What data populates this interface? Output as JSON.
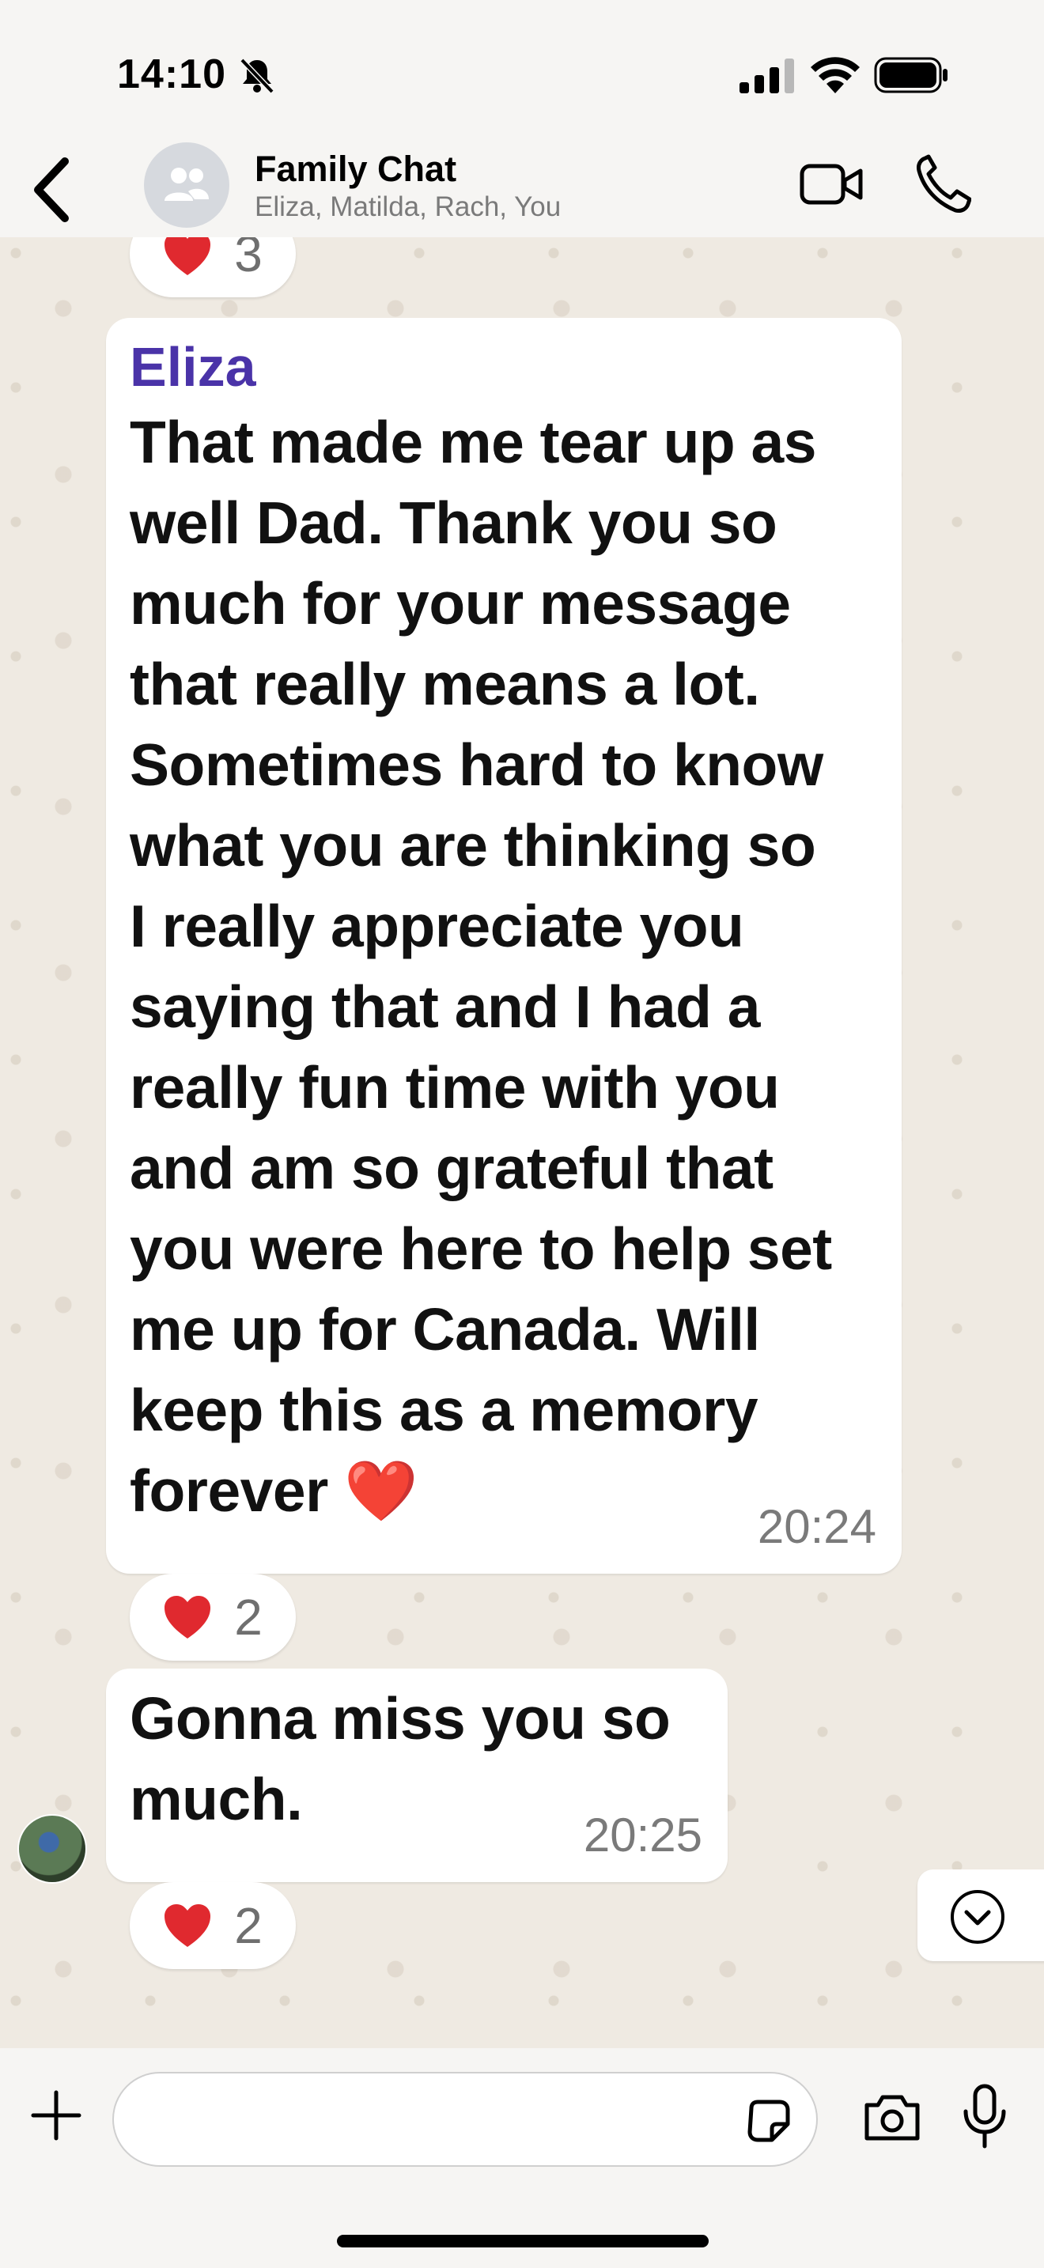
{
  "status_bar": {
    "time": "14:10"
  },
  "header": {
    "title": "Family Chat",
    "members": "Eliza, Matilda, Rach, You"
  },
  "messages": [
    {
      "sender": "Eliza",
      "text": "That made me tear up as\nwell Dad. Thank you so\nmuch for your message\nthat really means a lot.\nSometimes hard to know\nwhat you are thinking so\nI really appreciate you\nsaying that and I had a\nreally fun time with you\nand am so grateful that\nyou were here to help set\nme up for Canada. Will\nkeep this as a memory\nforever ❤️",
      "time": "20:24",
      "reaction_count": "2"
    },
    {
      "text": "Gonna miss you so\nmuch.",
      "time": "20:25",
      "reaction_count": "2"
    }
  ],
  "previous_reaction_count": "3",
  "input": {
    "placeholder": ""
  },
  "colors": {
    "sender_name": "#4a33a8",
    "heart": "#e0292f",
    "chat_background": "#efeae2"
  },
  "icons": [
    "back-chevron-icon",
    "group-avatar-icon",
    "video-call-icon",
    "phone-call-icon",
    "chevron-down-icon",
    "plus-icon",
    "sticker-icon",
    "camera-icon",
    "microphone-icon",
    "muted-bell-icon",
    "signal-icon",
    "wifi-icon",
    "battery-icon"
  ]
}
